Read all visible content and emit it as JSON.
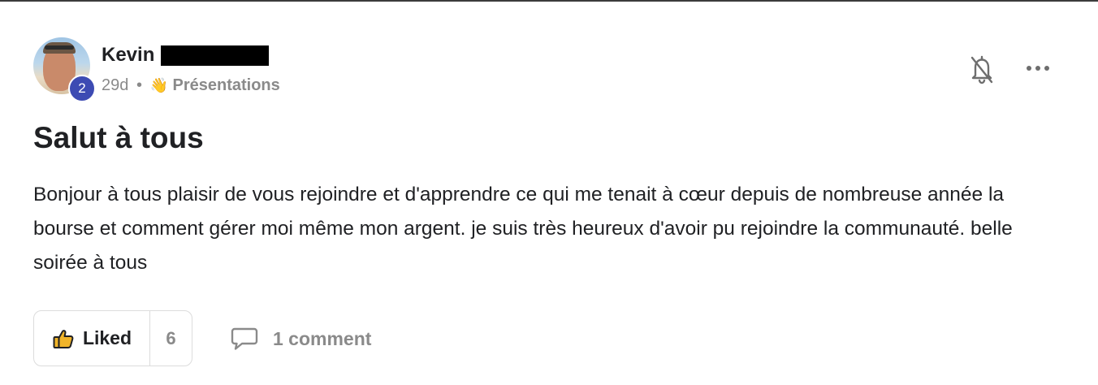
{
  "post": {
    "author": {
      "name": "Kevin",
      "level": "2",
      "avatar": "profile-photo"
    },
    "meta": {
      "time": "29d",
      "separator": "•",
      "category_emoji": "👋",
      "category": "Présentations"
    },
    "title": "Salut à tous",
    "body": "Bonjour à tous plaisir de vous rejoindre et d'apprendre ce qui me tenait à cœur depuis de nombreuse année la bourse et comment gérer moi même mon argent. je suis très heureux d'avoir pu rejoindre la communauté. belle soirée à tous",
    "actions": {
      "like_label": "Liked",
      "like_count": "6",
      "comment_label": "1 comment"
    },
    "icons": {
      "bell": "bell-off-icon",
      "more": "more-horizontal-icon",
      "like": "thumbs-up-icon",
      "comment": "comment-icon"
    },
    "colors": {
      "level_badge": "#3d4bb3",
      "muted_text": "#8a8a8a",
      "like_icon": "#f0b429"
    }
  }
}
